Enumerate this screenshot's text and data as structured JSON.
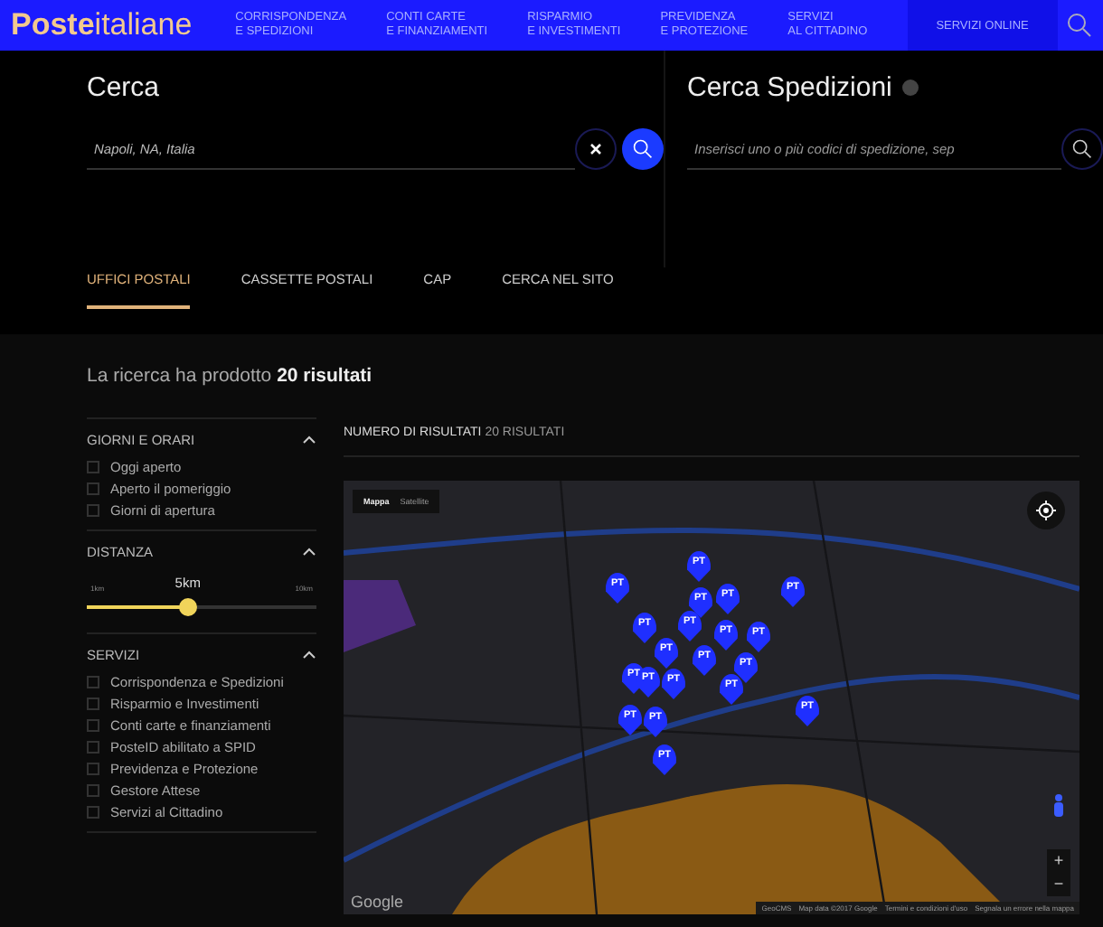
{
  "header": {
    "logo": "**Poste**italiane",
    "nav": [
      {
        "lines": [
          "CORRISPONDENZA",
          "E SPEDIZIONI"
        ]
      },
      {
        "lines": [
          "CONTI CARTE",
          "E FINANZIAMENTI"
        ]
      },
      {
        "lines": [
          "RISPARMIO",
          "E INVESTIMENTI"
        ]
      },
      {
        "lines": [
          "PREVIDENZA",
          "E PROTEZIONE"
        ]
      },
      {
        "lines": [
          "SERVIZI",
          "AL CITTADINO"
        ]
      }
    ],
    "online": "SERVIZI ONLINE"
  },
  "search": {
    "title": "Cerca",
    "value": "Napoli, NA, Italia"
  },
  "shipment": {
    "title": "Cerca Spedizioni",
    "placeholder": "Inserisci uno o più codici di spedizione, sep"
  },
  "tabs": [
    {
      "label": "UFFICI POSTALI",
      "selected": true
    },
    {
      "label": "CASSETTE POSTALI",
      "selected": false
    },
    {
      "label": "CAP",
      "selected": false
    },
    {
      "label": "CERCA NEL SITO",
      "selected": false
    }
  ],
  "summary": "La ricerca ha prodotto **20 risultati**",
  "filters": [
    {
      "kind": "checks",
      "title": "GIORNI E ORARI",
      "expanded": true,
      "items": [
        {
          "label": "Oggi aperto",
          "checked": false
        },
        {
          "label": "Aperto il pomeriggio",
          "checked": false
        },
        {
          "label": "Giorni di apertura",
          "checked": false
        }
      ]
    },
    {
      "kind": "slider",
      "title": "DISTANZA",
      "expanded": true,
      "min": "1km",
      "value": "5km",
      "max": "10km",
      "level": 0.44
    },
    {
      "kind": "checks",
      "title": "SERVIZI",
      "expanded": true,
      "items": [
        {
          "label": "Corrispondenza e Spedizioni",
          "checked": false
        },
        {
          "label": "Risparmio e Investimenti",
          "checked": false
        },
        {
          "label": "Conti carte e finanziamenti",
          "checked": false
        },
        {
          "label": "PosteID abilitato a SPID",
          "checked": false
        },
        {
          "label": "Previdenza e Protezione",
          "checked": false
        },
        {
          "label": "Gestore Attese",
          "checked": false
        },
        {
          "label": "Servizi al Cittadino",
          "checked": false
        }
      ]
    }
  ],
  "results": {
    "label": "NUMERO DI RISULTATI",
    "count": "20 RISULTATI"
  },
  "map": {
    "types": [
      {
        "label": "Mappa",
        "selected": true
      },
      {
        "label": "Satellite",
        "selected": false
      }
    ],
    "markers": [
      "PT",
      "PT",
      "PT",
      "PT",
      "PT",
      "PT",
      "PT",
      "PT",
      "PT",
      "PT",
      "PT",
      "PT",
      "PT",
      "PT",
      "PT",
      "PT",
      "PT",
      "PT",
      "PT",
      "PT"
    ],
    "zoom_in": "+",
    "zoom_out": "−",
    "logo": "Google",
    "attribution": [
      "GeoCMS",
      "Map data ©2017 Google",
      "Termini e condizioni d'uso",
      "Segnala un errore nella mappa"
    ]
  }
}
